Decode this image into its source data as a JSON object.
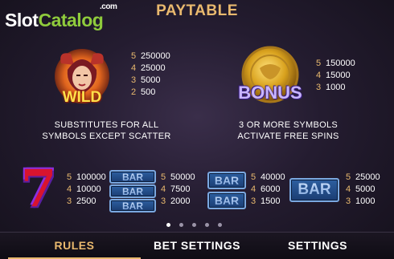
{
  "watermark": {
    "slot": "Slot",
    "catalog": "Catalog",
    "com": ".com"
  },
  "header": {
    "title": "PAYTABLE"
  },
  "wild": {
    "label": "WILD",
    "payouts": [
      {
        "count": "5",
        "value": "250000"
      },
      {
        "count": "4",
        "value": "25000"
      },
      {
        "count": "3",
        "value": "5000"
      },
      {
        "count": "2",
        "value": "500"
      }
    ],
    "desc_line1": "SUBSTITUTES FOR ALL",
    "desc_line2": "SYMBOLS EXCEPT SCATTER"
  },
  "bonus": {
    "label": "BONUS",
    "payouts": [
      {
        "count": "5",
        "value": "150000"
      },
      {
        "count": "4",
        "value": "15000"
      },
      {
        "count": "3",
        "value": "1000"
      }
    ],
    "desc_line1": "3 OR MORE SYMBOLS",
    "desc_line2": "ACTIVATE FREE SPINS"
  },
  "seven": {
    "label": "7",
    "payouts": [
      {
        "count": "5",
        "value": "100000"
      },
      {
        "count": "4",
        "value": "10000"
      },
      {
        "count": "3",
        "value": "2500"
      }
    ]
  },
  "triple_bar": {
    "label": "BAR",
    "payouts": [
      {
        "count": "5",
        "value": "50000"
      },
      {
        "count": "4",
        "value": "7500"
      },
      {
        "count": "3",
        "value": "2000"
      }
    ]
  },
  "double_bar": {
    "label": "BAR",
    "payouts": [
      {
        "count": "5",
        "value": "40000"
      },
      {
        "count": "4",
        "value": "6000"
      },
      {
        "count": "3",
        "value": "1500"
      }
    ]
  },
  "single_bar": {
    "label": "BAR",
    "payouts": [
      {
        "count": "5",
        "value": "25000"
      },
      {
        "count": "4",
        "value": "5000"
      },
      {
        "count": "3",
        "value": "1000"
      }
    ]
  },
  "pager": {
    "pages": 5,
    "current": 1
  },
  "tabs": [
    {
      "label": "RULES",
      "active": true
    },
    {
      "label": "BET SETTINGS",
      "active": false
    },
    {
      "label": "SETTINGS",
      "active": false
    }
  ],
  "colors": {
    "accent": "#e9b96e",
    "logo_green": "#8fcb3c",
    "bar_blue": "#2d5fa0"
  }
}
